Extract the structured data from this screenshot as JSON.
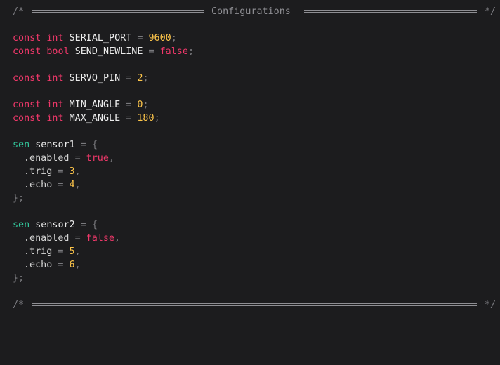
{
  "editor": {
    "header_comment": {
      "open": "/*",
      "title": "Configurations",
      "close": "*/"
    },
    "footer_comment": {
      "open": "/*",
      "close": "*/"
    },
    "lines": {
      "serial_port": {
        "kw": "const",
        "type": "int",
        "name": "SERIAL_PORT",
        "eq": "=",
        "value": "9600",
        "end": ";"
      },
      "send_newline": {
        "kw": "const",
        "type": "bool",
        "name": "SEND_NEWLINE",
        "eq": "=",
        "value": "false",
        "end": ";"
      },
      "servo_pin": {
        "kw": "const",
        "type": "int",
        "name": "SERVO_PIN",
        "eq": "=",
        "value": "2",
        "end": ";"
      },
      "min_angle": {
        "kw": "const",
        "type": "int",
        "name": "MIN_ANGLE",
        "eq": "=",
        "value": "0",
        "end": ";"
      },
      "max_angle": {
        "kw": "const",
        "type": "int",
        "name": "MAX_ANGLE",
        "eq": "=",
        "value": "180",
        "end": ";"
      }
    },
    "sensor1": {
      "type": "sen",
      "name": "sensor1",
      "eq": "=",
      "open": "{",
      "fields": [
        {
          "name": ".enabled",
          "eq": "=",
          "value": "true",
          "end": ","
        },
        {
          "name": ".trig",
          "eq": "=",
          "value": "3",
          "end": ","
        },
        {
          "name": ".echo",
          "eq": "=",
          "value": "4",
          "end": ","
        }
      ],
      "close": "};"
    },
    "sensor2": {
      "type": "sen",
      "name": "sensor2",
      "eq": "=",
      "open": "{",
      "fields": [
        {
          "name": ".enabled",
          "eq": "=",
          "value": "false",
          "end": ","
        },
        {
          "name": ".trig",
          "eq": "=",
          "value": "5",
          "end": ","
        },
        {
          "name": ".echo",
          "eq": "=",
          "value": "6",
          "end": ","
        }
      ],
      "close": "};"
    }
  },
  "colors": {
    "background": "#1c1c1e",
    "keyword": "#f0386a",
    "type_sen": "#32c59a",
    "number": "#fdc54a",
    "identifier": "#ececec",
    "comment": "#7b7b80"
  }
}
